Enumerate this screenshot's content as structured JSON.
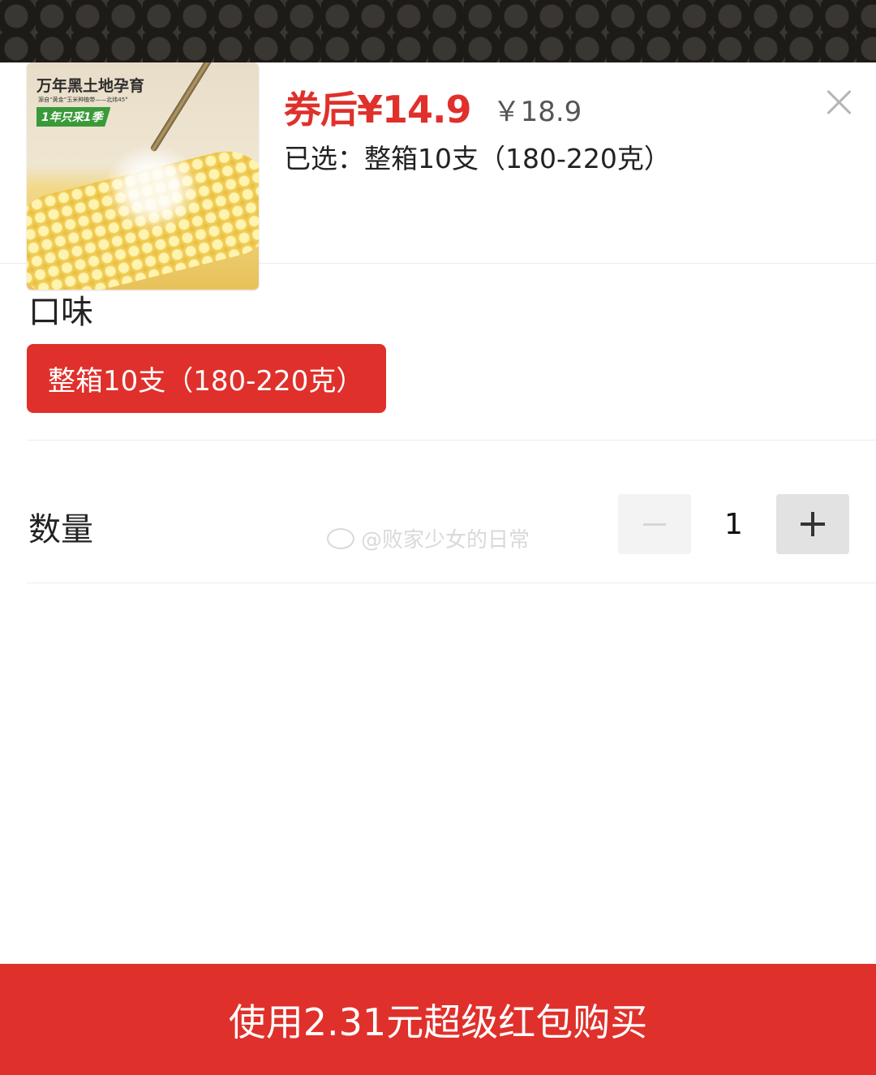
{
  "product": {
    "image_text": {
      "headline": "万年黑土地孕育",
      "tagline": "源自“黄金”玉米种植带——北纬45°",
      "badge": "1年只采1季"
    },
    "price_after_coupon": "券后¥14.9",
    "original_price": "￥18.9",
    "selected_label": "已选：整箱10支（180-220克）"
  },
  "flavor": {
    "title": "口味",
    "options": [
      {
        "label": "整箱10支（180-220克）",
        "selected": true
      }
    ]
  },
  "quantity": {
    "title": "数量",
    "value": "1",
    "minus_enabled": false
  },
  "watermark": "@败家少女的日常",
  "buy_button": {
    "label": "使用2.31元超级红包购买"
  },
  "colors": {
    "accent": "#e0302b",
    "text": "#222222",
    "divider": "#ececec"
  },
  "icons": {
    "close": "close-icon",
    "minus": "minus-icon",
    "plus": "plus-icon",
    "weibo": "weibo-icon"
  }
}
